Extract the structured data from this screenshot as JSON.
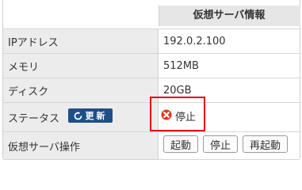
{
  "panel": {
    "title": "仮想サーバ情報"
  },
  "rows": [
    {
      "label": "IPアドレス",
      "value": "192.0.2.100"
    },
    {
      "label": "メモリ",
      "value": "512MB"
    },
    {
      "label": "ディスク",
      "value": "20GB"
    },
    {
      "label": "ステータス",
      "value": "停止"
    },
    {
      "label": "仮想サーバ操作"
    }
  ],
  "refresh": {
    "label": "更新",
    "icon": "refresh-icon"
  },
  "status": {
    "icon": "error-icon",
    "color": "#e63312",
    "highlight_color": "#e10010"
  },
  "operations": {
    "start_label": "起動",
    "stop_label": "停止",
    "restart_label": "再起動"
  }
}
